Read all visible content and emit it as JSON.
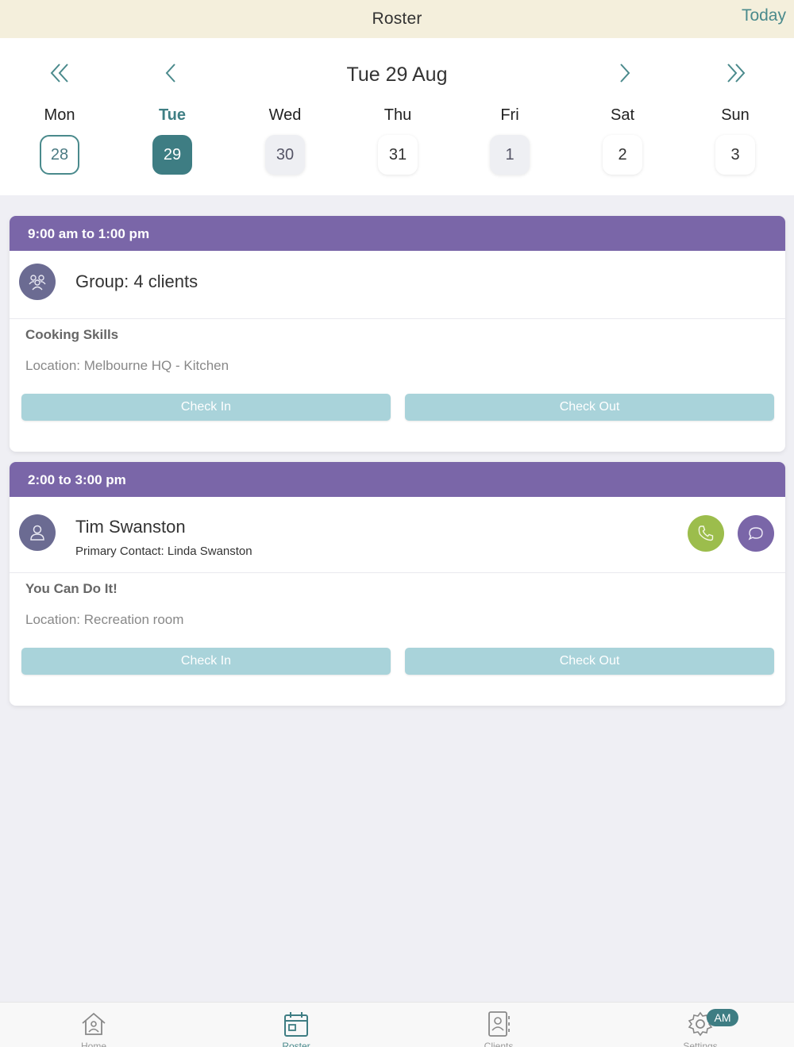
{
  "header": {
    "title": "Roster",
    "today_label": "Today"
  },
  "calendar": {
    "date_title": "Tue 29 Aug",
    "days": [
      {
        "name": "Mon",
        "num": "28",
        "state": "past"
      },
      {
        "name": "Tue",
        "num": "29",
        "state": "selected"
      },
      {
        "name": "Wed",
        "num": "30",
        "state": "grey"
      },
      {
        "name": "Thu",
        "num": "31",
        "state": "normal"
      },
      {
        "name": "Fri",
        "num": "1",
        "state": "grey"
      },
      {
        "name": "Sat",
        "num": "2",
        "state": "normal"
      },
      {
        "name": "Sun",
        "num": "3",
        "state": "normal"
      }
    ]
  },
  "shifts": [
    {
      "time": "9:00 am to 1:00 pm",
      "client": "Group: 4 clients",
      "activity": "Cooking Skills",
      "location": "Location: Melbourne HQ - Kitchen",
      "checkin_label": "Check In",
      "checkout_label": "Check Out"
    },
    {
      "time": "2:00 to 3:00 pm",
      "client": "Tim Swanston",
      "primary_contact": "Primary Contact: Linda Swanston",
      "activity": "You Can Do It!",
      "location": "Location: Recreation room",
      "checkin_label": "Check In",
      "checkout_label": "Check Out"
    }
  ],
  "tabs": [
    {
      "label": "Home",
      "icon": "home-icon"
    },
    {
      "label": "Roster",
      "icon": "calendar-icon"
    },
    {
      "label": "Clients",
      "icon": "contacts-icon"
    },
    {
      "label": "Settings",
      "icon": "gear-icon"
    }
  ],
  "settings_badge": "AM",
  "colors": {
    "header_bg": "#f4efdc",
    "accent_teal": "#3e7d83",
    "shift_purple": "#7a66a8",
    "call_green": "#9cbd4c",
    "button_light_teal": "#a9d3da"
  }
}
